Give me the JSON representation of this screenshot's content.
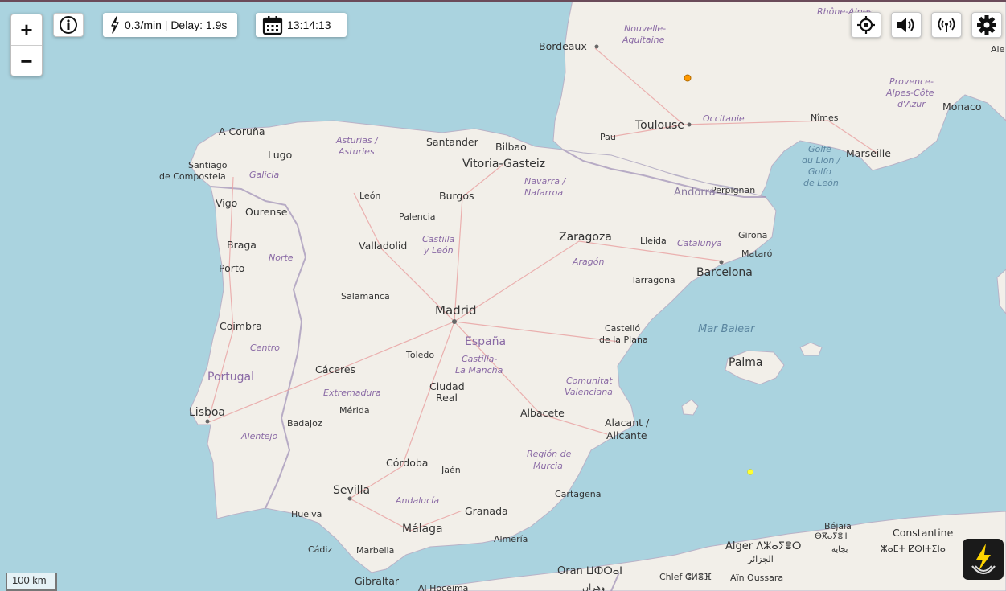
{
  "controls": {
    "zoom_in": "+",
    "zoom_out": "−",
    "rate_delay": "0.3/min | Delay: 1.9s",
    "time": "13:14:13",
    "icons": [
      "info-icon",
      "lightning-icon",
      "calendar-icon",
      "locate-icon",
      "sound-icon",
      "broadcast-icon",
      "gear-icon",
      "app-logo-icon"
    ]
  },
  "scale_label": "100 km",
  "colors": {
    "sea": "#aad3df",
    "land": "#f2efe9",
    "strike_orange": "#ff9900",
    "strike_yellow": "#ffff33",
    "border": "#9e8fb5"
  },
  "places": {
    "bordeaux": "Bordeaux",
    "nouvelle1": "Nouvelle-",
    "nouvelle2": "Aquitaine",
    "rhone": "Rhône-Alpes",
    "toulouse": "Toulouse",
    "occitanie": "Occitanie",
    "pau": "Pau",
    "nimes": "Nîmes",
    "marseille": "Marseille",
    "monaco": "Monaco",
    "provence1": "Provence-",
    "provence2": "Alpes-Côte",
    "provence3": "d'Azur",
    "ale": "Ale",
    "golfe1": "Golfe",
    "golfe2": "du Lion /",
    "golfe3": "Golfo",
    "golfe4": "de León",
    "acoruna": "A Coruña",
    "lugo": "Lugo",
    "santiago1": "Santiago",
    "santiago2": "de Compostela",
    "galicia": "Galicia",
    "asturias1": "Asturias /",
    "asturias2": "Asturies",
    "santander": "Santander",
    "bilbao": "Bilbao",
    "vitoria": "Vitoria-Gasteiz",
    "navarra1": "Navarra /",
    "navarra2": "Nafarroa",
    "andorra": "Andorra",
    "perpignan": "Perpignan",
    "vigo": "Vigo",
    "ourense": "Ourense",
    "leon": "León",
    "burgos": "Burgos",
    "palencia": "Palencia",
    "braga": "Braga",
    "valladolid": "Valladolid",
    "castilla1": "Castilla",
    "castilla2": "y León",
    "zaragoza": "Zaragoza",
    "lleida": "Lleida",
    "catalunya": "Catalunya",
    "girona": "Girona",
    "mataro": "Mataró",
    "porto": "Porto",
    "norte": "Norte",
    "aragon": "Aragón",
    "tarragona": "Tarragona",
    "barcelona": "Barcelona",
    "salamanca": "Salamanca",
    "madrid": "Madrid",
    "espana": "España",
    "coimbra": "Coimbra",
    "centro": "Centro",
    "toledo": "Toledo",
    "castillam1": "Castilla-",
    "castillam2": "La Mancha",
    "castello1": "Castelló",
    "castello2": "de la Plana",
    "marbalear": "Mar Balear",
    "palma": "Palma",
    "portugal": "Portugal",
    "caceres": "Cáceres",
    "extremadura": "Extremadura",
    "ciudad1": "Ciudad",
    "ciudad2": "Real",
    "comunitat1": "Comunitat",
    "comunitat2": "Valenciana",
    "lisboa": "Lisboa",
    "badajoz": "Badajoz",
    "merida": "Mérida",
    "albacete": "Albacete",
    "alacant1": "Alacant /",
    "alacant2": "Alicante",
    "alentejo": "Alentejo",
    "cordoba": "Córdoba",
    "jaen": "Jaén",
    "murcia1": "Región de",
    "murcia2": "Murcia",
    "sevilla": "Sevilla",
    "cartagena": "Cartagena",
    "andalucia": "Andalucía",
    "granada": "Granada",
    "huelva": "Huelva",
    "malaga": "Málaga",
    "almeria": "Almería",
    "cadiz": "Cádiz",
    "marbella": "Marbella",
    "gibraltar": "Gibraltar",
    "alhoceima": "Al Hoceima",
    "oran": "Oran ⵡⵀⵔⴰⵏ",
    "wahran": "وهران",
    "bejaia": "Béjaïa",
    "bejaia_ar": "بجاية",
    "bejaia_tif": "ⴱⴳⴰⵢⴻⵜ",
    "constantine": "Constantine",
    "constantine_tif": "ⵣⴰⵎⵜ ⵇⵙⵏⵜⵉⵏⴰ",
    "alger": "Alger ⴷⵣⴰⵢⴻⵔ",
    "alger_ar": "الجزائر",
    "chlef": "Chlef ⵛⵍⴻⴼ",
    "ainoussara": "Aïn Oussara"
  }
}
